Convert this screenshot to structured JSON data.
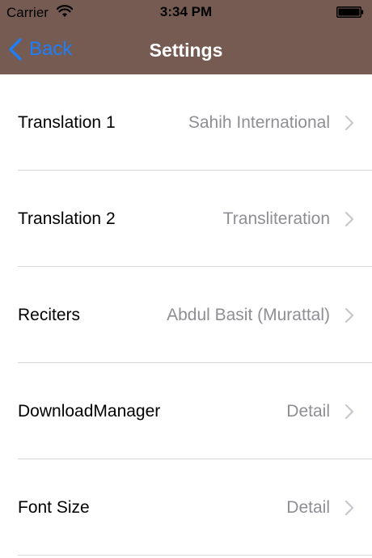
{
  "status_bar": {
    "carrier": "Carrier",
    "time": "3:34 PM"
  },
  "nav": {
    "back_label": "Back",
    "title": "Settings"
  },
  "colors": {
    "header_background": "#765b52",
    "accent": "#1e7ef8",
    "detail_text": "#8e8e93"
  },
  "rows": [
    {
      "label": "Translation 1",
      "detail": "Sahih International"
    },
    {
      "label": "Translation 2",
      "detail": "Transliteration"
    },
    {
      "label": "Reciters",
      "detail": "Abdul Basit (Murattal)"
    },
    {
      "label": "DownloadManager",
      "detail": "Detail"
    },
    {
      "label": "Font Size",
      "detail": "Detail"
    }
  ]
}
